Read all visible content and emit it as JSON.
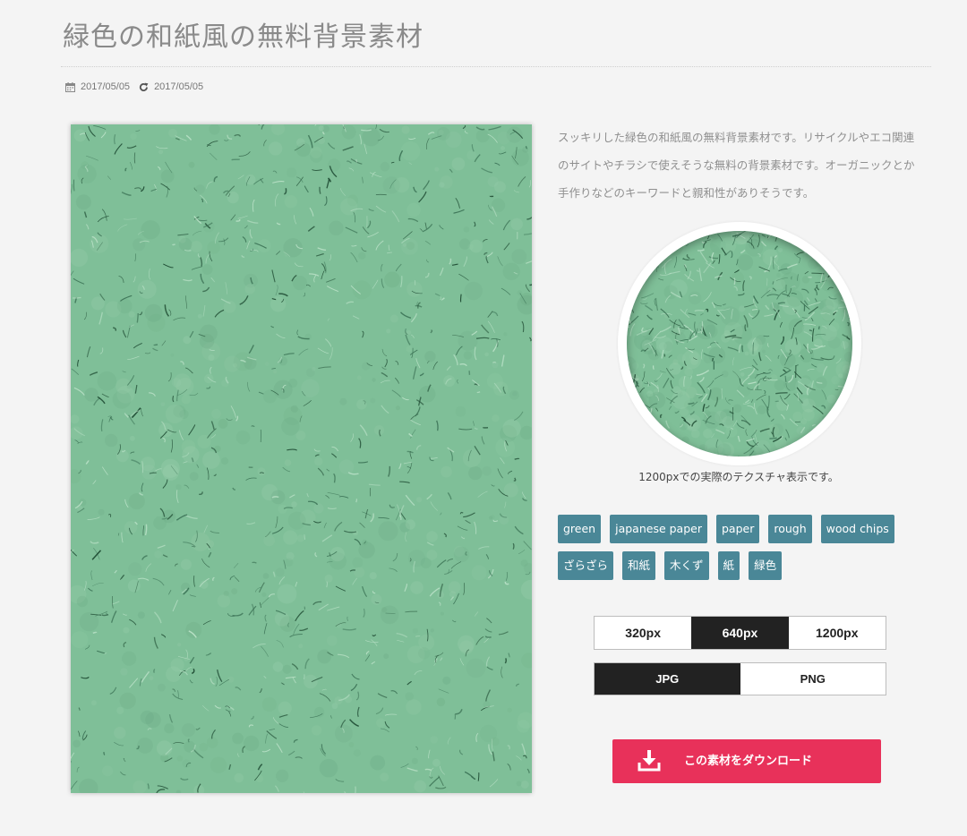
{
  "article": {
    "title": "緑色の和紙風の無料背景素材",
    "published_date": "2017/05/05",
    "updated_date": "2017/05/05",
    "description": "スッキリした緑色の和紙風の無料背景素材です。リサイクルやエコ関連のサイトやチラシで使えそうな無料の背景素材です。オーガニックとか手作りなどのキーワードと親和性がありそうです。"
  },
  "preview": {
    "caption": "1200pxでの実際のテクスチャ表示です。",
    "texture_color": "#7fbf98"
  },
  "tags": {
    "row1": [
      "green",
      "japanese paper",
      "paper",
      "rough",
      "wood chips"
    ],
    "row2": [
      "ざらざら",
      "和紙",
      "木くず",
      "紙",
      "緑色"
    ]
  },
  "size_options": {
    "items": [
      "320px",
      "640px",
      "1200px"
    ],
    "selected": "640px"
  },
  "format_options": {
    "items": [
      "JPG",
      "PNG"
    ],
    "selected": "JPG"
  },
  "download": {
    "label": "この素材をダウンロード"
  },
  "colors": {
    "tag_bg": "#4a8797",
    "download_bg": "#e8315a",
    "active_option_bg": "#222222"
  }
}
